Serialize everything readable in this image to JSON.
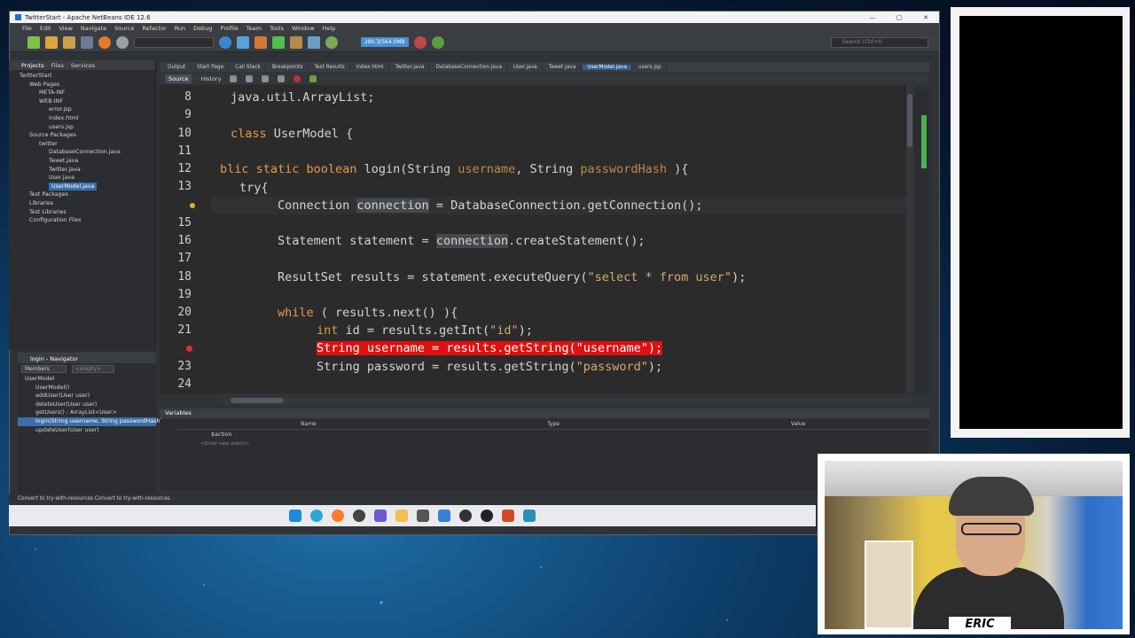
{
  "window": {
    "title": "TwitterStart - Apache NetBeans IDE 12.6",
    "controls": [
      "—",
      "▢",
      "✕"
    ]
  },
  "menu": [
    "File",
    "Edit",
    "View",
    "Navigate",
    "Source",
    "Refactor",
    "Run",
    "Debug",
    "Profile",
    "Team",
    "Tools",
    "Window",
    "Help"
  ],
  "toolbar": {
    "memory": "280.3/564.0MB",
    "search_placeholder": "Search (Ctrl+I)"
  },
  "projects_panel": {
    "tabs": [
      "Projects",
      "Files",
      "Services"
    ],
    "tree": [
      {
        "label": "TwitterStart",
        "indent": 0
      },
      {
        "label": "Web Pages",
        "indent": 1
      },
      {
        "label": "META-INF",
        "indent": 2
      },
      {
        "label": "WEB-INF",
        "indent": 2
      },
      {
        "label": "error.jsp",
        "indent": 3
      },
      {
        "label": "index.html",
        "indent": 3
      },
      {
        "label": "users.jsp",
        "indent": 3
      },
      {
        "label": "Source Packages",
        "indent": 1
      },
      {
        "label": "twitter",
        "indent": 2
      },
      {
        "label": "DatabaseConnection.java",
        "indent": 3
      },
      {
        "label": "Tweet.java",
        "indent": 3
      },
      {
        "label": "Twitter.java",
        "indent": 3
      },
      {
        "label": "User.java",
        "indent": 3
      },
      {
        "label": "UserModel.java",
        "indent": 3,
        "selected": true
      },
      {
        "label": "Test Packages",
        "indent": 1
      },
      {
        "label": "Libraries",
        "indent": 1
      },
      {
        "label": "Test Libraries",
        "indent": 1
      },
      {
        "label": "Configuration Files",
        "indent": 1
      }
    ]
  },
  "navigator": {
    "title": "login - Navigator",
    "filter": "Members",
    "filter_placeholder": "<empty>",
    "items": [
      {
        "label": "UserModel"
      },
      {
        "label": "UserModel()"
      },
      {
        "label": "addUser(User user)"
      },
      {
        "label": "deleteUser(User user)"
      },
      {
        "label": "getUsers() : ArrayList<User>"
      },
      {
        "label": "login(String username, String passwordHash)",
        "selected": true
      },
      {
        "label": "updateUser(User user)"
      }
    ]
  },
  "editor": {
    "tabs": [
      {
        "label": "Output"
      },
      {
        "label": "Start Page"
      },
      {
        "label": "Call Stack"
      },
      {
        "label": "Breakpoints"
      },
      {
        "label": "Test Results"
      },
      {
        "label": "index.html"
      },
      {
        "label": "Twitter.java"
      },
      {
        "label": "DatabaseConnection.java"
      },
      {
        "label": "User.java"
      },
      {
        "label": "Tweet.java"
      },
      {
        "label": "UserModel.java",
        "active": true
      },
      {
        "label": "users.jsp"
      }
    ],
    "source_tab": "Source",
    "history_tab": "History",
    "line_numbers": [
      "8",
      "9",
      "10",
      "11",
      "12",
      "13",
      "",
      "15",
      "16",
      "17",
      "18",
      "19",
      "20",
      "21",
      "",
      "23",
      "24"
    ]
  },
  "code": {
    "l8": "java.util.ArrayList;",
    "l10_kw": "class",
    "l10_rest": " UserModel {",
    "l12_kw": "blic static boolean",
    "l12_a": " login(String ",
    "l12_p1": "username",
    "l12_b": ", String ",
    "l12_p2": "passwordHash",
    "l12_c": " ){",
    "l13": "try{",
    "l14_a": "Connection ",
    "l14_hl": "connection",
    "l14_b": " = DatabaseConnection.getConnection();",
    "l16_a": "Statement statement = ",
    "l16_hl": "connection",
    "l16_b": ".createStatement();",
    "l18_a": "ResultSet results = statement.executeQuery(",
    "l18_str": "\"select * from user\"",
    "l18_b": ");",
    "l20_kw": "while",
    "l20_rest": " ( results.next() ){",
    "l21_kw": "int",
    "l21_a": " id = results.getInt(",
    "l21_str": "\"id\"",
    "l21_b": ");",
    "l22": "String username = results.getString(\"username\");",
    "l23_a": "String password = results.getString(",
    "l23_str": "\"password\"",
    "l23_b": ");"
  },
  "variables_panel": {
    "tab": "Variables",
    "columns": [
      "Name",
      "Type",
      "Value"
    ],
    "row1": "$action",
    "row2": "<Enter new watch>"
  },
  "status": "Convert to try-with-resources  Convert to try-with-resources",
  "webcam": {
    "name_tag": "ERIC"
  }
}
